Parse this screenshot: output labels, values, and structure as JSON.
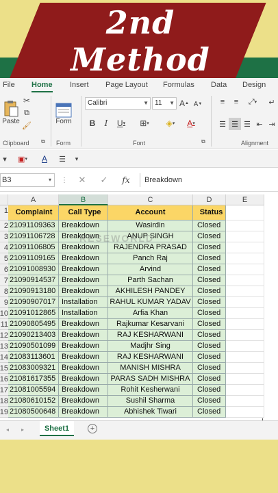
{
  "banner": {
    "line1": "2nd",
    "line2": "Method"
  },
  "ribbon": {
    "tabs": [
      "File",
      "Home",
      "Insert",
      "Page Layout",
      "Formulas",
      "Data",
      "Design"
    ],
    "active_tab": "Home",
    "paste_label": "Paste",
    "form_label": "Form",
    "font_name": "Calibri",
    "font_size": "11",
    "groups": {
      "clipboard": "Clipboard",
      "form": "Form",
      "font": "Font",
      "alignment": "Alignment"
    }
  },
  "formula_bar": {
    "name_box": "B3",
    "fx": "fx",
    "content": "Breakdown"
  },
  "grid": {
    "columns": [
      "A",
      "B",
      "C",
      "D",
      "E"
    ],
    "row_numbers": [
      "1",
      "2",
      "3",
      "4",
      "5",
      "6",
      "7",
      "8",
      "9",
      "10",
      "11",
      "12",
      "13",
      "14",
      "15",
      "16",
      "17",
      "18",
      "19"
    ],
    "headers": [
      "Complaint",
      "Call Type",
      "Account",
      "Status"
    ],
    "rows": [
      [
        "21091109363",
        "Breakdown",
        "Wasirdin",
        "Closed"
      ],
      [
        "21091106728",
        "Breakdown",
        "ANUP SINGH",
        "Closed"
      ],
      [
        "21091106805",
        "Breakdown",
        "RAJENDRA PRASAD",
        "Closed"
      ],
      [
        "21091109165",
        "Breakdown",
        "Panch Raj",
        "Closed"
      ],
      [
        "21091008930",
        "Breakdown",
        "Arvind",
        "Closed"
      ],
      [
        "21090914537",
        "Breakdown",
        "Parth Sachan",
        "Closed"
      ],
      [
        "21090913180",
        "Breakdown",
        "AKHILESH PANDEY",
        "Closed"
      ],
      [
        "21090907017",
        "Installation",
        "RAHUL KUMAR YADAV",
        "Closed"
      ],
      [
        "21091012865",
        "Installation",
        "Arfia Khan",
        "Closed"
      ],
      [
        "21090805495",
        "Breakdown",
        "Rajkumar Kesarvani",
        "Closed"
      ],
      [
        "21090213403",
        "Breakdown",
        "RAJ KESHARWANI",
        "Closed"
      ],
      [
        "21090501099",
        "Breakdown",
        "Madjhr Sing",
        "Closed"
      ],
      [
        "21083113601",
        "Breakdown",
        "RAJ KESHARWANI",
        "Closed"
      ],
      [
        "21083009321",
        "Breakdown",
        "MANISH MISHRA",
        "Closed"
      ],
      [
        "21081617355",
        "Breakdown",
        "PARAS SADH MISHRA",
        "Closed"
      ],
      [
        "21081005594",
        "Breakdown",
        "Rohit Kesherwani",
        "Closed"
      ],
      [
        "21080610152",
        "Breakdown",
        "Sushil Sharma",
        "Closed"
      ],
      [
        "21080500648",
        "Breakdown",
        "Abhishek Tiwari",
        "Closed"
      ]
    ]
  },
  "sheet_tab": "Sheet1",
  "watermark": "RESEWORLD",
  "colors": {
    "excel_green": "#1e7145",
    "banner_red": "#8f1b1b",
    "header_fill": "#fbd666",
    "data_fill": "#dcefd7",
    "background": "#ece089"
  }
}
